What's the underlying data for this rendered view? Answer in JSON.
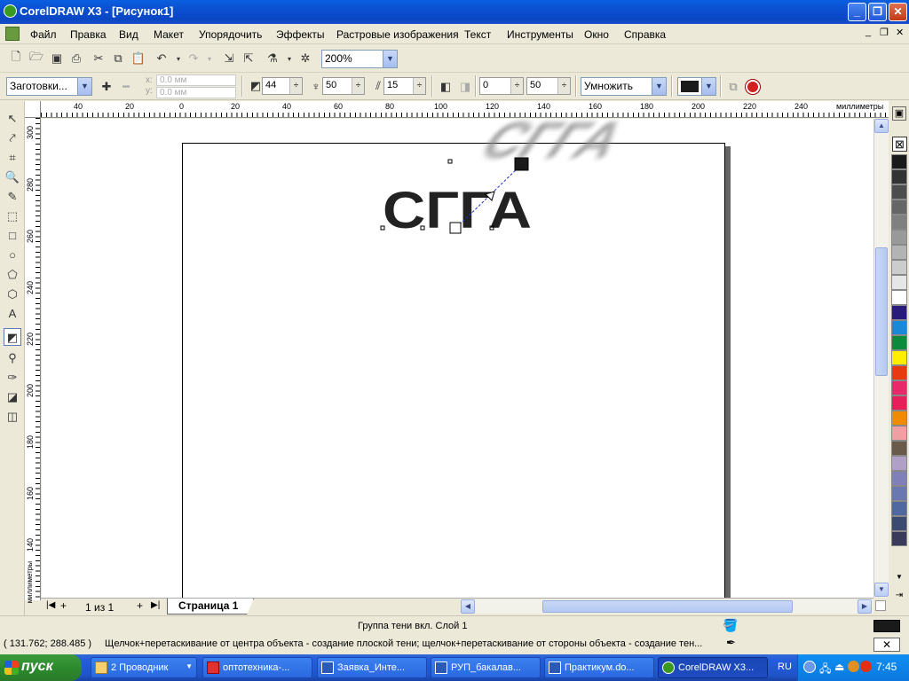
{
  "window": {
    "title": "CorelDRAW X3 - [Рисунок1]"
  },
  "menu": [
    "Файл",
    "Правка",
    "Вид",
    "Макет",
    "Упорядочить",
    "Эффекты",
    "Растровые изображения",
    "Текст",
    "Инструменты",
    "Окно",
    "Справка"
  ],
  "toolbar": {
    "zoom": "200%"
  },
  "propbar": {
    "preset": "Заготовки...",
    "x_value": "0.0 мм",
    "y_value": "0.0 мм",
    "opacity": "44",
    "feather": "50",
    "stretch": "15",
    "fade": "0",
    "stretch2": "50",
    "mode": "Умножить"
  },
  "ruler": {
    "unit": "миллиметры",
    "h_ticks": [
      "40",
      "20",
      "0",
      "20",
      "40",
      "60",
      "80",
      "100",
      "120",
      "140",
      "160",
      "180",
      "200",
      "220",
      "240"
    ],
    "v_ticks": [
      "300",
      "280",
      "260",
      "240",
      "220",
      "200",
      "180",
      "160",
      "140"
    ]
  },
  "canvas": {
    "artwork_text": "СГГА"
  },
  "pagebar": {
    "page_count": "1 из 1",
    "page_tab": "Страница 1"
  },
  "status": {
    "object_info": "Группа тени  вкл. Слой 1",
    "coords": "( 131.762; 288.485 )",
    "hint": "Щелчок+перетаскивание от центра объекта - создание плоской тени; щелчок+перетаскивание от стороны объекта - создание тен..."
  },
  "taskbar": {
    "start": "пуск",
    "tasks": [
      "2 Проводник",
      "оптотехника-...",
      "Заявка_Инте...",
      "РУП_бакалав...",
      "Практикум.do...",
      "CorelDRAW X3..."
    ],
    "lang": "RU",
    "clock": "7:45"
  },
  "palette_colors": [
    "#1a1a1a",
    "#333333",
    "#4d4d4d",
    "#666666",
    "#808080",
    "#999999",
    "#b3b3b3",
    "#cccccc",
    "#e6e6e6",
    "#ffffff",
    "#2a1a7a",
    "#1a88d8",
    "#0a8a3a",
    "#ffee00",
    "#e83a10",
    "#e82a6a",
    "#e8205a",
    "#f08a00",
    "#f0a0a0",
    "#6a5a4a",
    "#b0a0c8",
    "#8080b8",
    "#6a78b0",
    "#5068a0",
    "#3a4a70",
    "#3a3a5a"
  ]
}
